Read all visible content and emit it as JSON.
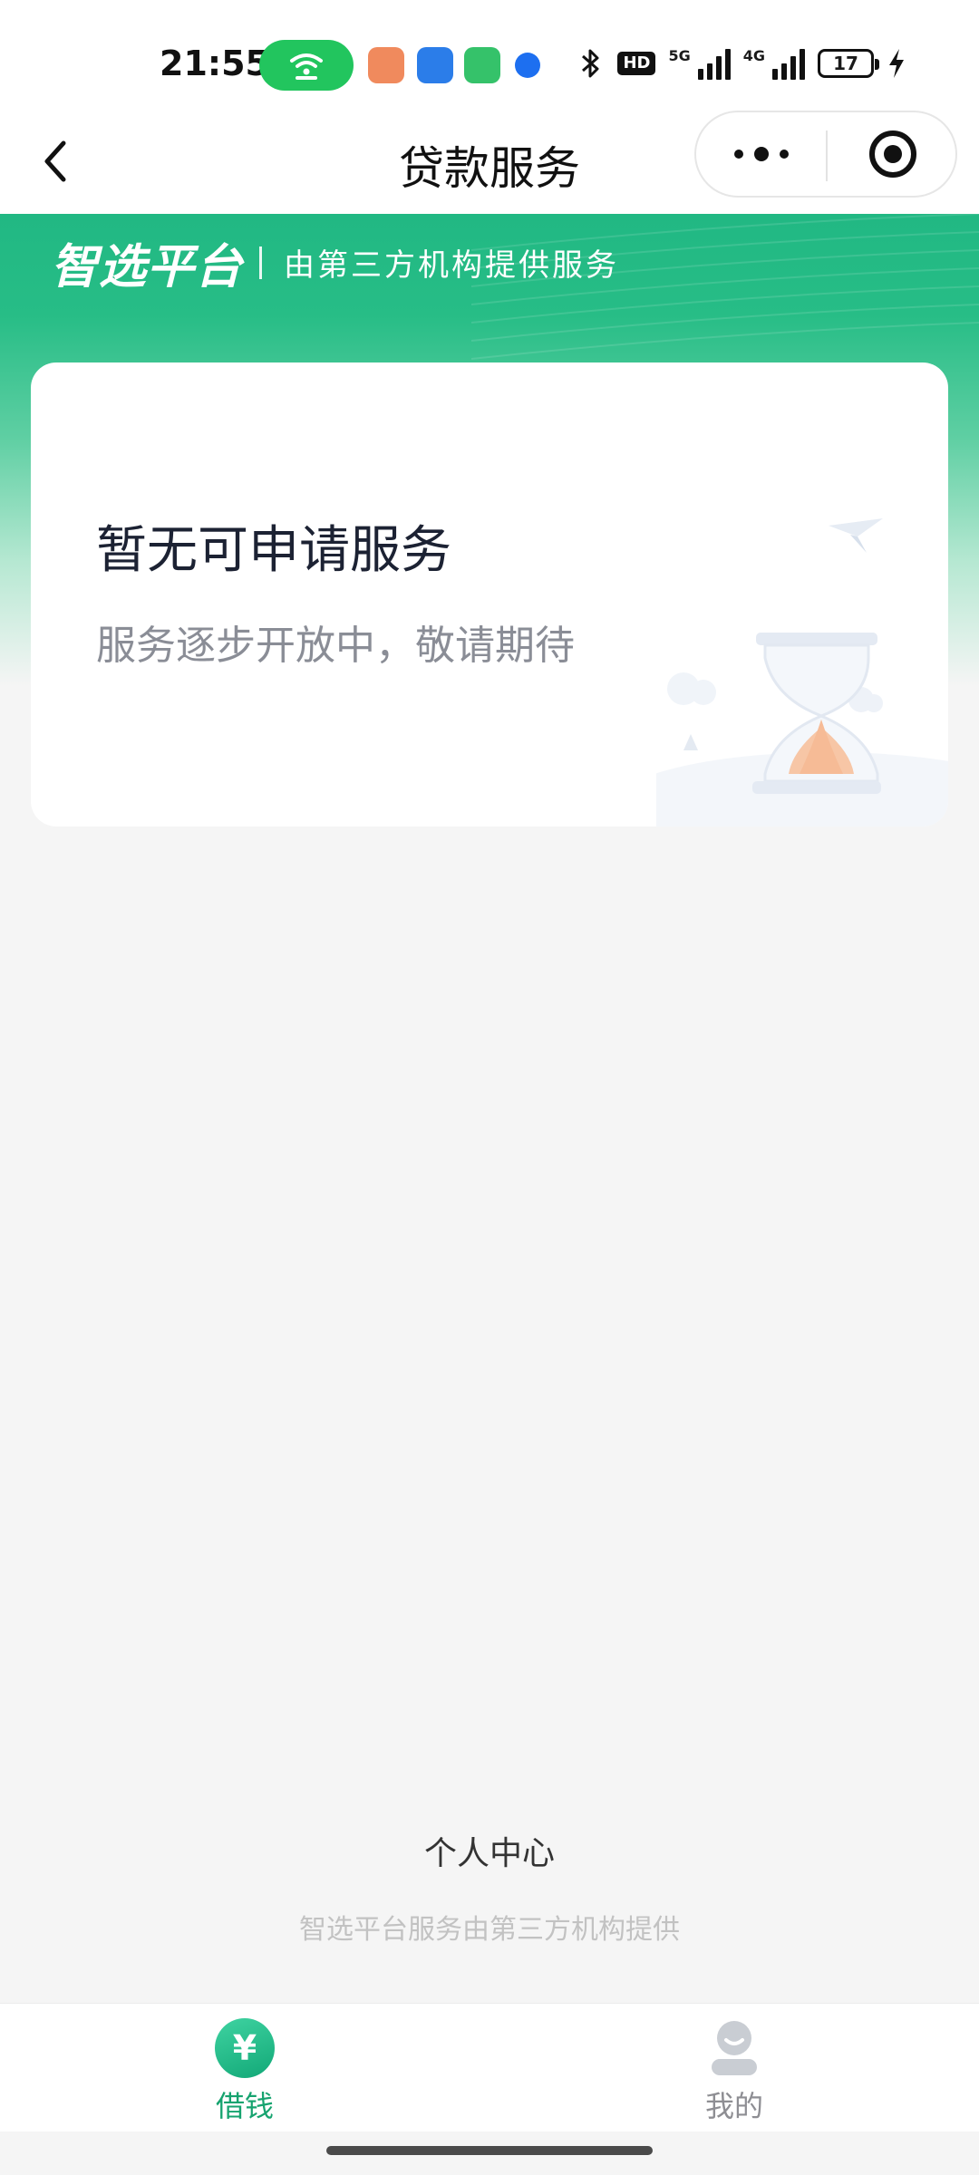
{
  "status_bar": {
    "time": "21:55",
    "hd_label": "HD",
    "signal_1_label": "5G",
    "signal_2_label": "4G",
    "battery_level": "17"
  },
  "nav": {
    "title": "贷款服务"
  },
  "header": {
    "brand": "智选平台",
    "subtitle": "由第三方机构提供服务"
  },
  "empty_state": {
    "title": "暂无可申请服务",
    "subtitle": "服务逐步开放中，敬请期待"
  },
  "footer": {
    "personal_center": "个人中心",
    "disclaimer": "智选平台服务由第三方机构提供"
  },
  "tab_bar": {
    "tabs": [
      {
        "label": "借钱",
        "icon": "yen-icon",
        "active": true,
        "icon_symbol": "¥"
      },
      {
        "label": "我的",
        "icon": "user-icon",
        "active": false
      }
    ]
  },
  "colors": {
    "brand_green": "#21b883",
    "active_tab": "#16a36f",
    "inactive_tab": "#8e8e93",
    "hotspot": "#22c55e"
  }
}
